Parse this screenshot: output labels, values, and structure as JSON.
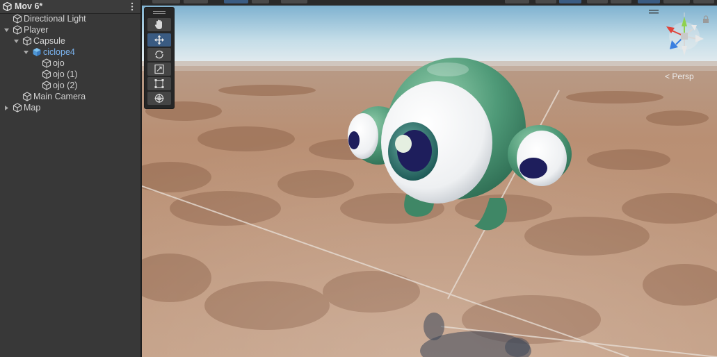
{
  "hierarchy": {
    "scene_name": "Mov 6*",
    "items": [
      {
        "label": "Directional Light",
        "depth": 1,
        "fold": "none",
        "prefab": false
      },
      {
        "label": "Player",
        "depth": 0,
        "fold": "open",
        "prefab": false
      },
      {
        "label": "Capsule",
        "depth": 1,
        "fold": "open",
        "prefab": false
      },
      {
        "label": "ciclope4",
        "depth": 2,
        "fold": "open",
        "prefab": true
      },
      {
        "label": "ojo",
        "depth": 3,
        "fold": "none",
        "prefab": false
      },
      {
        "label": "ojo (1)",
        "depth": 3,
        "fold": "none",
        "prefab": false
      },
      {
        "label": "ojo (2)",
        "depth": 3,
        "fold": "none",
        "prefab": false
      },
      {
        "label": "Main Camera",
        "depth": 1,
        "fold": "none",
        "prefab": false
      },
      {
        "label": "Map",
        "depth": 0,
        "fold": "closed",
        "prefab": false
      }
    ]
  },
  "scene_view": {
    "camera_mode": "Persp",
    "tools": [
      {
        "name": "hand-tool",
        "icon": "hand-icon",
        "active": false
      },
      {
        "name": "move-tool",
        "icon": "move-arrows-icon",
        "active": true
      },
      {
        "name": "rotate-tool",
        "icon": "rotate-icon",
        "active": false
      },
      {
        "name": "scale-tool",
        "icon": "scale-icon",
        "active": false
      },
      {
        "name": "rect-tool",
        "icon": "rect-icon",
        "active": false
      },
      {
        "name": "transform-tool",
        "icon": "transform-icon",
        "active": false
      }
    ],
    "gizmo_axes": {
      "x": "#e0433a",
      "y": "#8fd14f",
      "z": "#3a7fe0"
    }
  },
  "colors": {
    "panel_bg": "#383838",
    "selected_text": "#7bb4f0",
    "tool_active": "#3a5b82",
    "character_green": "#4f9a78"
  }
}
